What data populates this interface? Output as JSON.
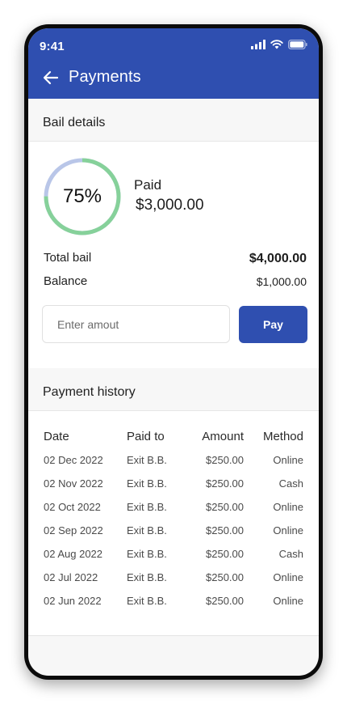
{
  "status_bar": {
    "time": "9:41"
  },
  "app_bar": {
    "title": "Payments"
  },
  "bail": {
    "section_title": "Bail details",
    "paid_percent": 75,
    "paid_percent_label": "75%",
    "paid_label": "Paid",
    "paid_amount": "$3,000.00",
    "total_label": "Total bail",
    "total_value": "$4,000.00",
    "balance_label": "Balance",
    "balance_value": "$1,000.00",
    "amount_placeholder": "Enter amout",
    "pay_label": "Pay"
  },
  "history": {
    "section_title": "Payment history",
    "columns": [
      "Date",
      "Paid to",
      "Amount",
      "Method"
    ],
    "rows": [
      {
        "date": "02 Dec 2022",
        "paid_to": "Exit B.B.",
        "amount": "$250.00",
        "method": "Online"
      },
      {
        "date": "02 Nov 2022",
        "paid_to": "Exit B.B.",
        "amount": "$250.00",
        "method": "Cash"
      },
      {
        "date": "02 Oct 2022",
        "paid_to": "Exit B.B.",
        "amount": "$250.00",
        "method": "Online"
      },
      {
        "date": "02 Sep 2022",
        "paid_to": "Exit B.B.",
        "amount": "$250.00",
        "method": "Online"
      },
      {
        "date": "02 Aug 2022",
        "paid_to": "Exit B.B.",
        "amount": "$250.00",
        "method": "Cash"
      },
      {
        "date": "02 Jul 2022",
        "paid_to": "Exit B.B.",
        "amount": "$250.00",
        "method": "Online"
      },
      {
        "date": "02 Jun 2022",
        "paid_to": "Exit B.B.",
        "amount": "$250.00",
        "method": "Online"
      }
    ]
  },
  "colors": {
    "primary": "#2f4fb0",
    "progress_paid": "#86d19a",
    "progress_remaining": "#b9c6e8"
  },
  "icons": [
    "back-arrow-icon",
    "signal-icon",
    "wifi-icon",
    "battery-icon"
  ]
}
